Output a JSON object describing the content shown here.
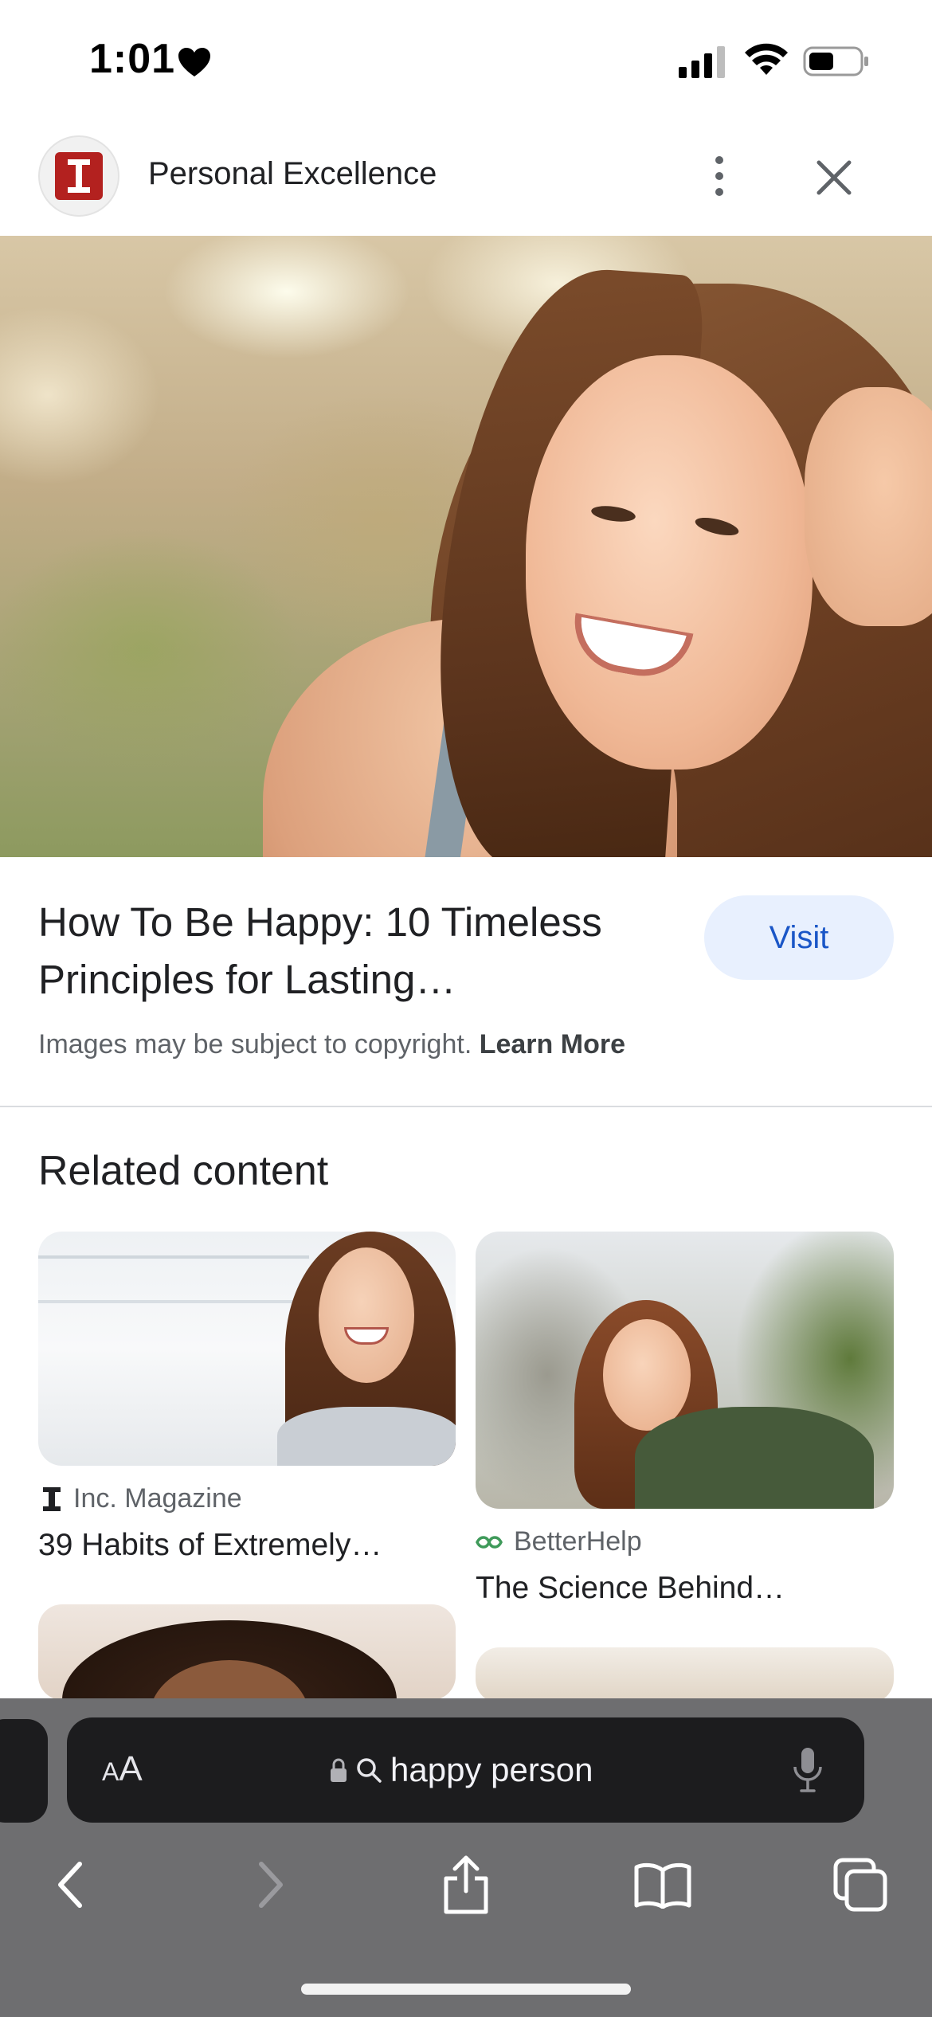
{
  "status_bar": {
    "time": "1:01",
    "icons": [
      "heart-icon",
      "signal-icon",
      "wifi-icon",
      "battery-icon"
    ]
  },
  "header": {
    "site_name": "Personal Excellence",
    "logo_letter": "I",
    "brand_color": "#b3211f",
    "icons": [
      "more-vert-icon",
      "close-icon"
    ]
  },
  "result": {
    "title": "How To Be Happy: 10 Timeless Principles for Lasting…",
    "visit_label": "Visit",
    "copyright_text": "Images may be subject to copyright.",
    "learn_more_label": "Learn More",
    "accent_color": "#1a56c7"
  },
  "related": {
    "heading": "Related content",
    "cards": [
      {
        "source": "Inc. Magazine",
        "title": "39 Habits of Extremely…"
      },
      {
        "source": "BetterHelp",
        "title": "The Science Behind…"
      }
    ]
  },
  "browser": {
    "aa_label_small": "A",
    "aa_label_large": "A",
    "address": "happy person",
    "toolbar": [
      "back-icon",
      "forward-icon",
      "share-icon",
      "bookmarks-icon",
      "tabs-icon"
    ]
  }
}
